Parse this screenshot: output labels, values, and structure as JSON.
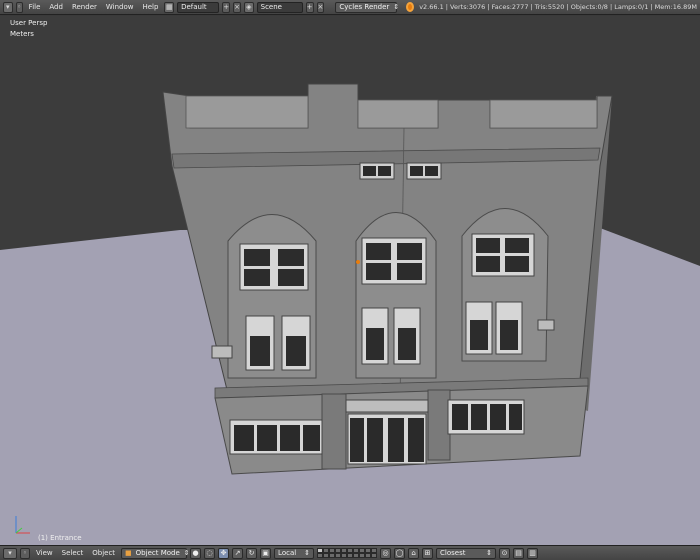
{
  "top_header": {
    "menus": [
      "File",
      "Add",
      "Render",
      "Window",
      "Help"
    ],
    "layout": "Default",
    "scene": "Scene",
    "render_engine": "Cycles Render",
    "stats": "v2.66.1 | Verts:3076 | Faces:2777 | Tris:5520 | Objects:0/8 | Lamps:0/1 | Mem:16.89M"
  },
  "viewport": {
    "view_name": "User Persp",
    "units": "Meters",
    "object_label": "(1) Entrance"
  },
  "bottom_header": {
    "menus": [
      "View",
      "Select",
      "Object"
    ],
    "mode": "Object Mode",
    "pivot_space": "Local",
    "snap_target": "Closest"
  },
  "colors": {
    "background": "#3c3c3c",
    "ground": "#a3a1b3",
    "building": "#838383",
    "accent": "#e87d0d"
  }
}
